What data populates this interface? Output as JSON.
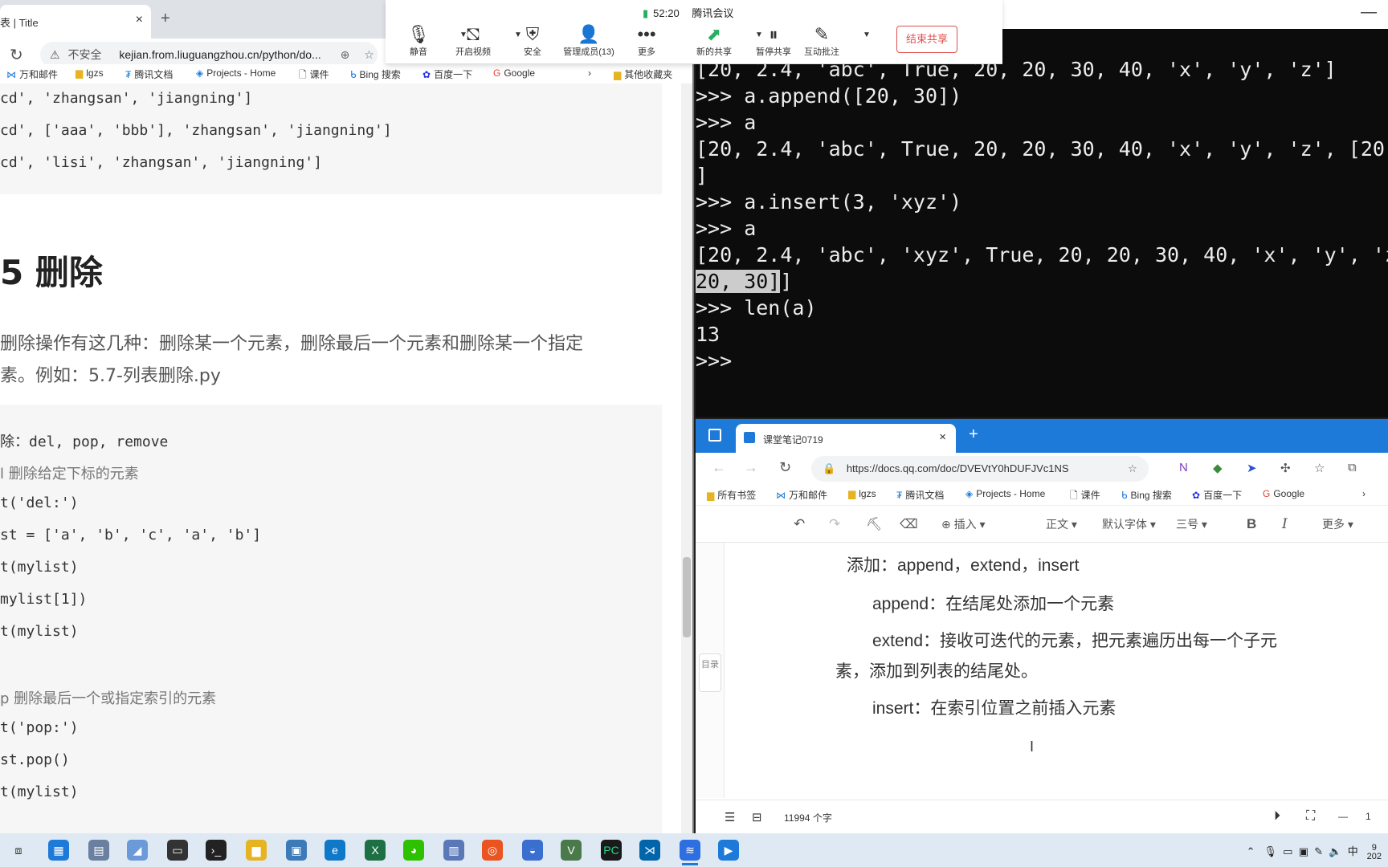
{
  "left_browser": {
    "tab_title": "表 | Title",
    "tab_close": "×",
    "new_tab": "+",
    "reload": "↻",
    "insecure": "不安全",
    "url": "kejian.from.liuguangzhou.cn/python/do...",
    "bookmarks": [
      "万和邮件",
      "lgzs",
      "腾讯文档",
      "Projects - Home",
      "课件",
      "Bing 搜索",
      "百度一下",
      "Google",
      "其他收藏夹"
    ],
    "code_top": [
      "cd', 'zhangsan', 'jiangning']",
      "cd', ['aaa', 'bbb'], 'zhangsan', 'jiangning']",
      "cd', 'lisi', 'zhangsan', 'jiangning']"
    ],
    "heading": "5 删除",
    "para1": "删除操作有这几种：删除某一个元素，删除最后一个元素和删除某一个指定",
    "para2": "素。例如：5.7-列表删除.py",
    "code_main": [
      "除：del, pop, remove",
      "l 删除给定下标的元素",
      "t('del:')",
      "st = ['a', 'b', 'c', 'a', 'b']",
      "t(mylist)",
      "mylist[1])",
      "t(mylist)",
      "",
      "p 删除最后一个或指定索引的元素",
      "t('pop:')",
      "st.pop()",
      "t(mylist)"
    ]
  },
  "terminal": {
    "minimize": "—",
    "lines": [
      "[20, 2.4, 'abc', True, 20, 20, 30, 40, 'x', 'y', 'z']",
      ">>> a.append([20, 30])",
      ">>> a",
      "[20, 2.4, 'abc', True, 20, 20, 30, 40, 'x', 'y', 'z', [20,",
      "]",
      ">>> a.insert(3, 'xyz')",
      ">>> a",
      "[20, 2.4, 'abc', 'xyz', True, 20, 20, 30, 40, 'x', 'y', 'z"
    ],
    "selected": "20, 30]",
    "after_selected": "]",
    "lines_after": [
      ">>> len(a)",
      "13",
      ">>>"
    ]
  },
  "meeting": {
    "time": "52:20",
    "app": "腾讯会议",
    "buttons": [
      "静音",
      "开启视频",
      "安全",
      "管理成员(13)",
      "更多",
      "新的共享",
      "暂停共享",
      "互动批注"
    ],
    "end_share": "结束共享"
  },
  "docs": {
    "tab_title": "课堂笔记0719",
    "tab_close": "×",
    "new_tab": "+",
    "url": "https://docs.qq.com/doc/DVEVtY0hDUFJVc1NS",
    "bookmarks": [
      "所有书签",
      "万和邮件",
      "lgzs",
      "腾讯文档",
      "Projects - Home",
      "课件",
      "Bing 搜索",
      "百度一下",
      "Google"
    ],
    "toolbar": {
      "insert": "插入",
      "style": "正文",
      "font": "默认字体",
      "size": "三号",
      "bold": "B",
      "italic": "I",
      "more": "更多"
    },
    "toc": "目录",
    "content": [
      "添加：append，extend，insert",
      "append：在结尾处添加一个元素",
      "extend：接收可迭代的元素，把元素遍历出每一个子元",
      "素，添加到列表的结尾处。",
      "insert：在索引位置之前插入元素"
    ],
    "word_count": "11994 个字",
    "zoom_minus": "—",
    "zoom_value": "1"
  },
  "taskbar": {
    "tray_ime": "中",
    "tray_time": "9",
    "tray_year": "202"
  },
  "colors": {
    "accent": "#1e7ad8",
    "end_share": "#e05050",
    "signal": "#27ae60"
  }
}
